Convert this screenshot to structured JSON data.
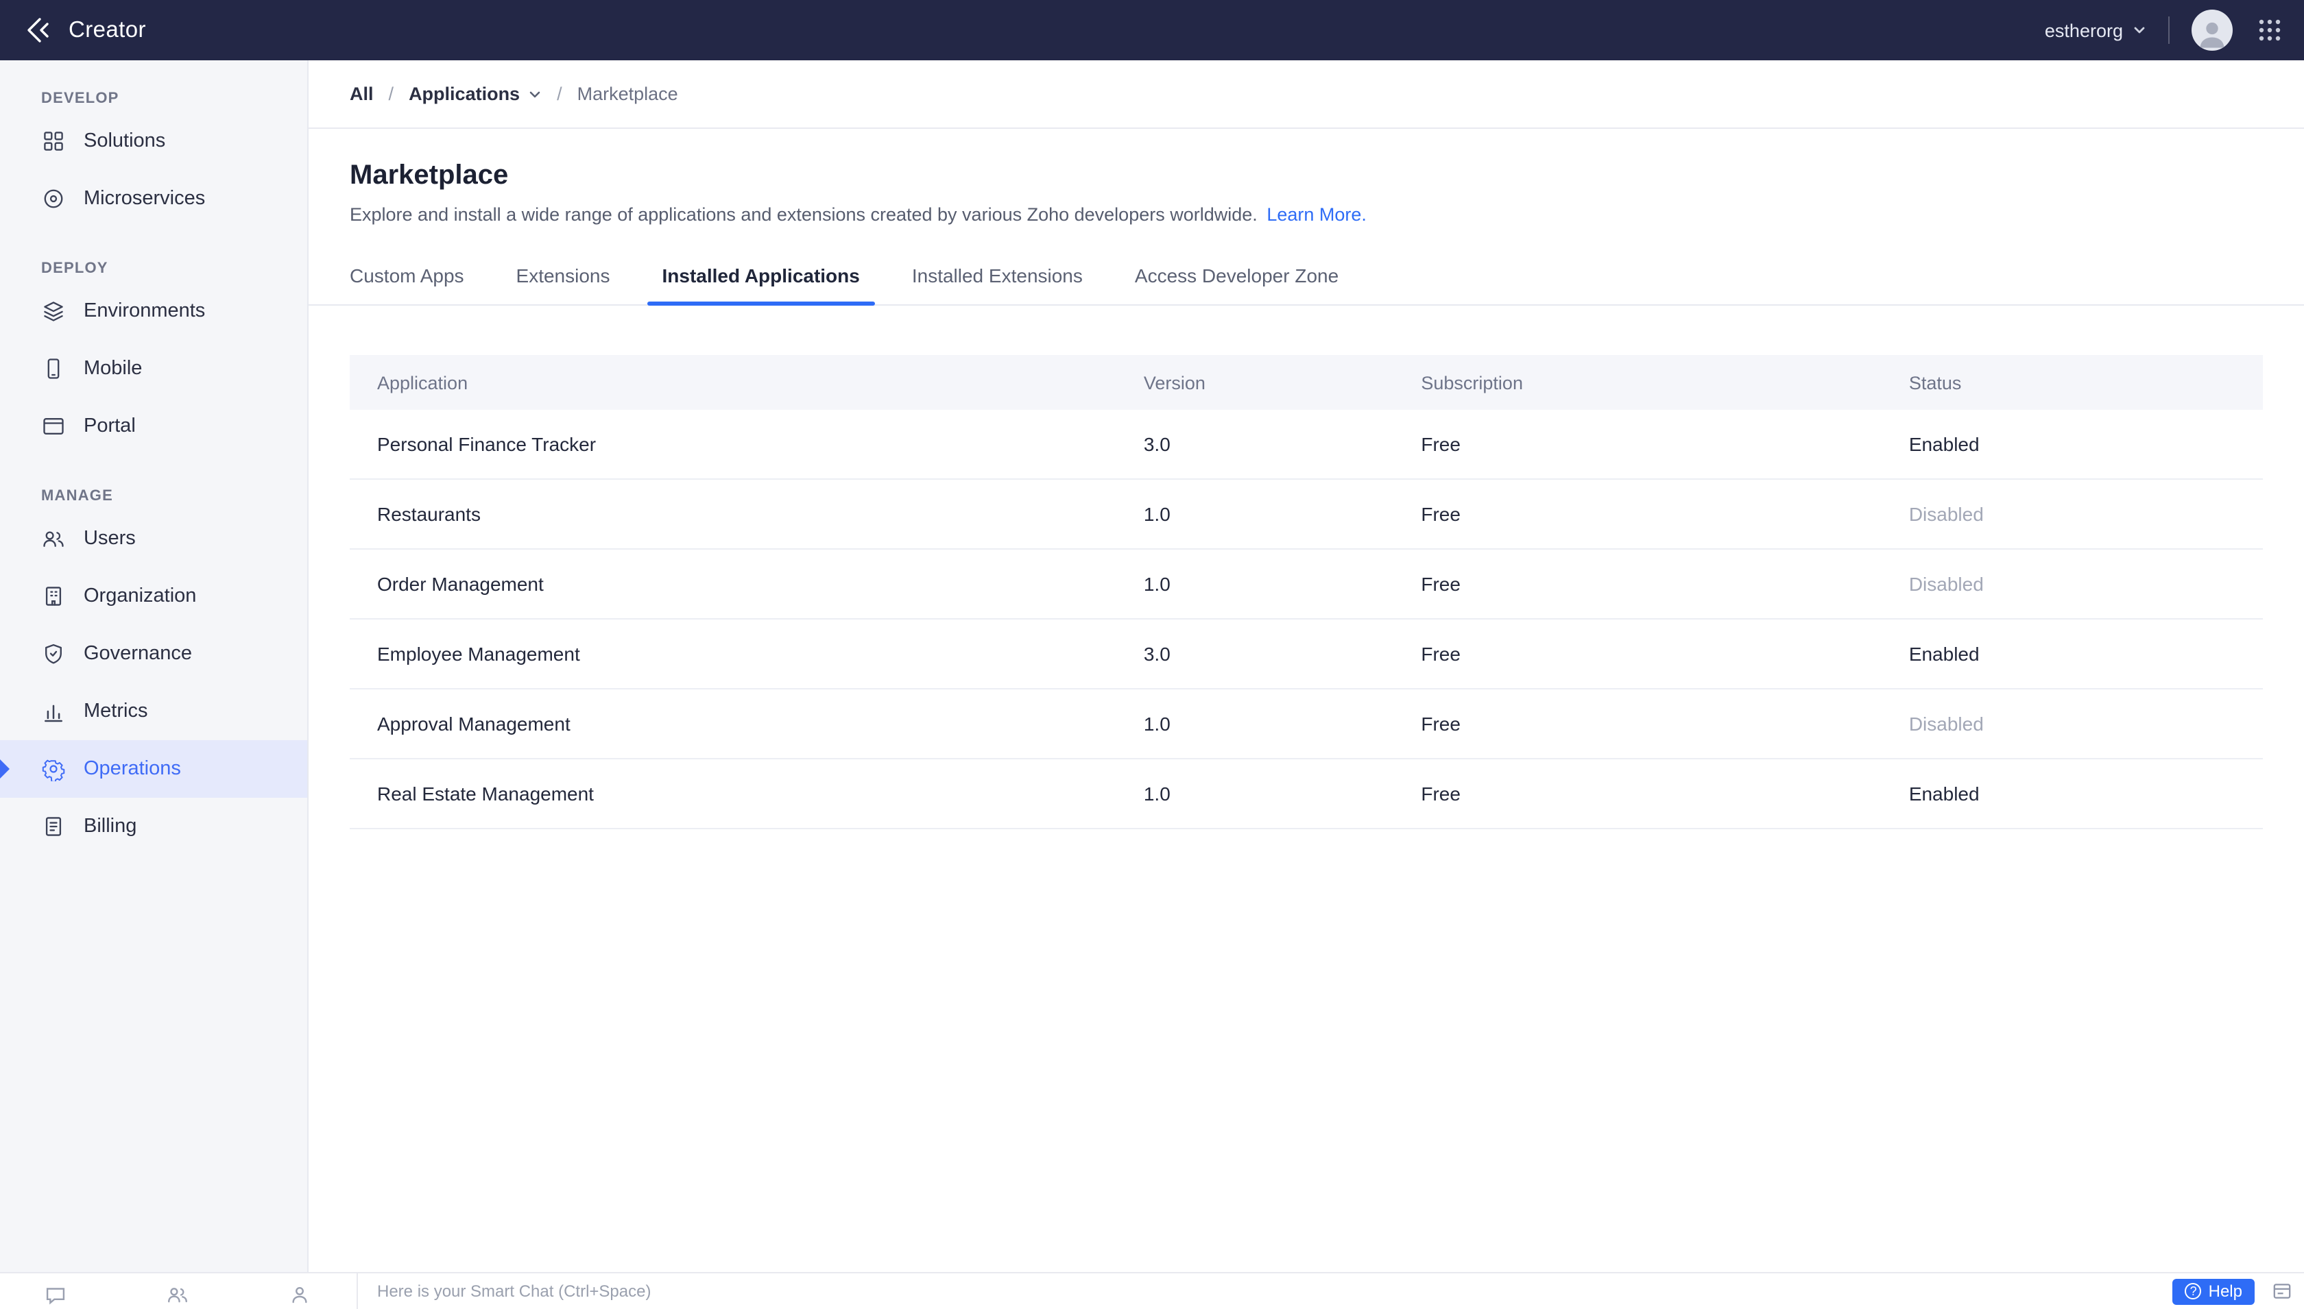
{
  "topbar": {
    "app_name": "Creator",
    "org_name": "estherorg"
  },
  "sidebar": {
    "sections": [
      {
        "label": "DEVELOP",
        "items": [
          {
            "label": "Solutions"
          },
          {
            "label": "Microservices"
          }
        ]
      },
      {
        "label": "DEPLOY",
        "items": [
          {
            "label": "Environments"
          },
          {
            "label": "Mobile"
          },
          {
            "label": "Portal"
          }
        ]
      },
      {
        "label": "MANAGE",
        "items": [
          {
            "label": "Users"
          },
          {
            "label": "Organization"
          },
          {
            "label": "Governance"
          },
          {
            "label": "Metrics"
          },
          {
            "label": "Operations",
            "active": true
          },
          {
            "label": "Billing"
          }
        ]
      }
    ]
  },
  "breadcrumb": {
    "separator": "/",
    "items": [
      "All",
      "Applications",
      "Marketplace"
    ]
  },
  "page": {
    "title": "Marketplace",
    "description": "Explore and install a wide range of applications and extensions created by various Zoho developers worldwide.",
    "learn_more": "Learn More."
  },
  "tabs": [
    {
      "label": "Custom Apps",
      "active": false
    },
    {
      "label": "Extensions",
      "active": false
    },
    {
      "label": "Installed Applications",
      "active": true
    },
    {
      "label": "Installed Extensions",
      "active": false
    },
    {
      "label": "Access Developer Zone",
      "active": false
    }
  ],
  "table": {
    "headers": [
      "Application",
      "Version",
      "Subscription",
      "Status"
    ],
    "rows": [
      {
        "application": "Personal Finance Tracker",
        "version": "3.0",
        "subscription": "Free",
        "status": "Enabled",
        "status_state": "enabled"
      },
      {
        "application": "Restaurants",
        "version": "1.0",
        "subscription": "Free",
        "status": "Disabled",
        "status_state": "disabled"
      },
      {
        "application": "Order Management",
        "version": "1.0",
        "subscription": "Free",
        "status": "Disabled",
        "status_state": "disabled"
      },
      {
        "application": "Employee Management",
        "version": "3.0",
        "subscription": "Free",
        "status": "Enabled",
        "status_state": "enabled"
      },
      {
        "application": "Approval Management",
        "version": "1.0",
        "subscription": "Free",
        "status": "Disabled",
        "status_state": "disabled"
      },
      {
        "application": "Real Estate Management",
        "version": "1.0",
        "subscription": "Free",
        "status": "Enabled",
        "status_state": "enabled"
      }
    ]
  },
  "footer": {
    "chat_placeholder": "Here is your Smart Chat (Ctrl+Space)",
    "help_label": "Help",
    "help_icon": "?"
  },
  "colors": {
    "accent": "#2e6cf6",
    "topbar_bg": "#232746",
    "sidebar_bg": "#f5f6f9",
    "disabled_text": "#a2a7b6"
  }
}
